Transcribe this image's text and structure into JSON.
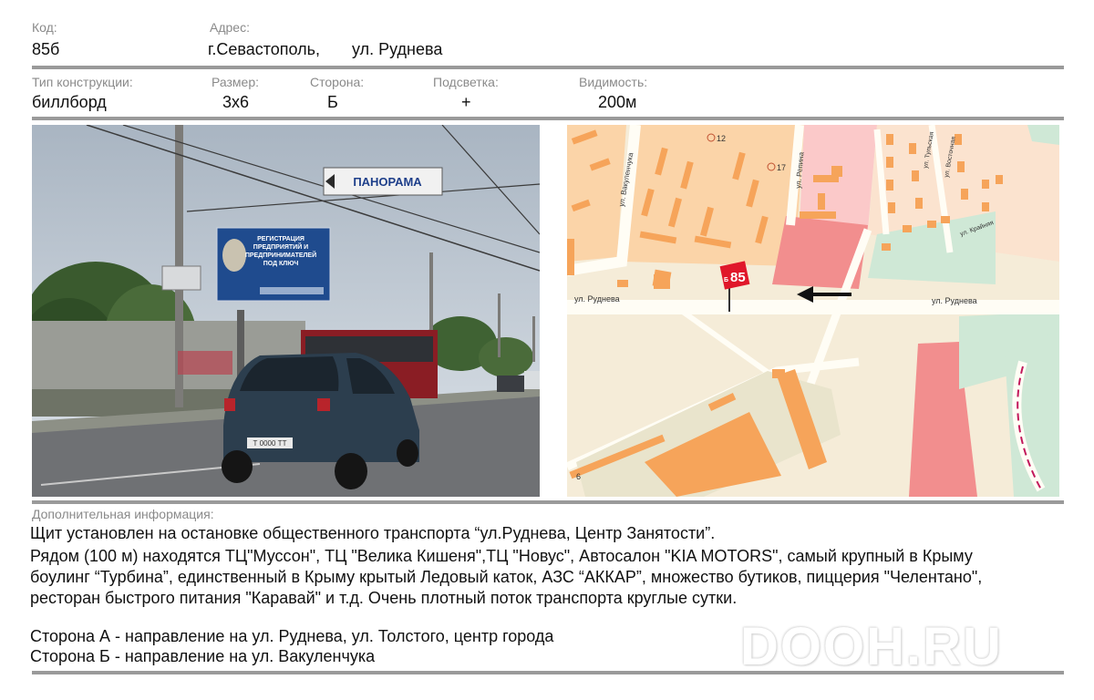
{
  "header": {
    "code_label": "Код:",
    "code_value": "85б",
    "address_label": "Адрес:",
    "address_city": "г.Севастополь,",
    "address_street": "ул. Руднева"
  },
  "specs": {
    "type_label": "Тип конструкции:",
    "type_value": "биллборд",
    "size_label": "Размер:",
    "size_value": "3х6",
    "side_label": "Сторона:",
    "side_value": "Б",
    "light_label": "Подсветка:",
    "light_value": "+",
    "visibility_label": "Видимость:",
    "visibility_value": "200м"
  },
  "photo": {
    "billboard_lines": [
      "РЕГИСТРАЦИЯ",
      "ПРЕДПРИЯТИЙ И",
      "ПРЕДПРИНИМАТЕЛЕЙ",
      "ПОД КЛЮЧ"
    ],
    "banner_text": "ПАНОРАМА",
    "plate_text": "Т 0000 ТТ"
  },
  "map": {
    "street_left": "ул. Руднева",
    "street_right": "ул. Руднева",
    "street_vakulenchuka": "ул. Вакуленчука",
    "street_repina": "ул. Репина",
    "street_tulskaya": "ул. Тульская",
    "street_vostochnaya": "ул. Восточная",
    "street_krainyaya": "ул. Крайняя",
    "house_12": "12",
    "house_17": "17",
    "house_6": "6",
    "marker_prefix": "Б",
    "marker_number": "85"
  },
  "info": {
    "label": "Дополнительная информация:",
    "line1": "Щит установлен на остановке общественного транспорта “ул.Руднева, Центр Занятости”.",
    "line2": "Рядом (100 м) находятся ТЦ\"Муссон\", ТЦ \"Велика Кишеня\",ТЦ \"Новус\", Автосалон \"KIA MOTORS\", самый крупный в Крыму",
    "line3": "боулинг “Турбина”, единственный в Крыму крытый Ледовый каток, АЗС “АККАР”, множество бутиков, пиццерия \"Челентано\",",
    "line4": "ресторан быстрого питания \"Каравай\" и т.д. Очень плотный поток транспорта круглые сутки.",
    "side_a": "Сторона А -  направление на ул. Руднева, ул. Толстого, центр города",
    "side_b": "Сторона Б -  направление на ул. Вакуленчука"
  },
  "watermark": "DOOH.RU",
  "colors": {
    "rule": "#9a9a9a",
    "label_gray": "#8a8a8a",
    "map_orange": "#f6a45a",
    "map_peach": "#fbd4a8",
    "map_pink": "#f28e8e",
    "map_green": "#cfe8d6",
    "marker_red": "#e0172a"
  }
}
